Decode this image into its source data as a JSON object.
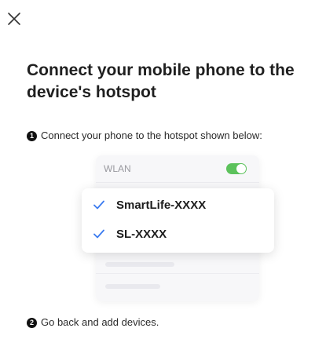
{
  "header": {
    "close_icon": "close-icon"
  },
  "title": "Connect your mobile phone to the device's hotspot",
  "steps": [
    {
      "number": "1",
      "text": "Connect your phone to the hotspot shown below:"
    },
    {
      "number": "2",
      "text": "Go back and add devices."
    }
  ],
  "wlan": {
    "label": "WLAN",
    "toggle_on": true,
    "toggle_color": "#5cc25c"
  },
  "hotspots": [
    {
      "name": "SmartLife-XXXX",
      "checked": true
    },
    {
      "name": "SL-XXXX",
      "checked": true
    }
  ],
  "colors": {
    "check": "#3b7bf0",
    "text": "#222222"
  }
}
